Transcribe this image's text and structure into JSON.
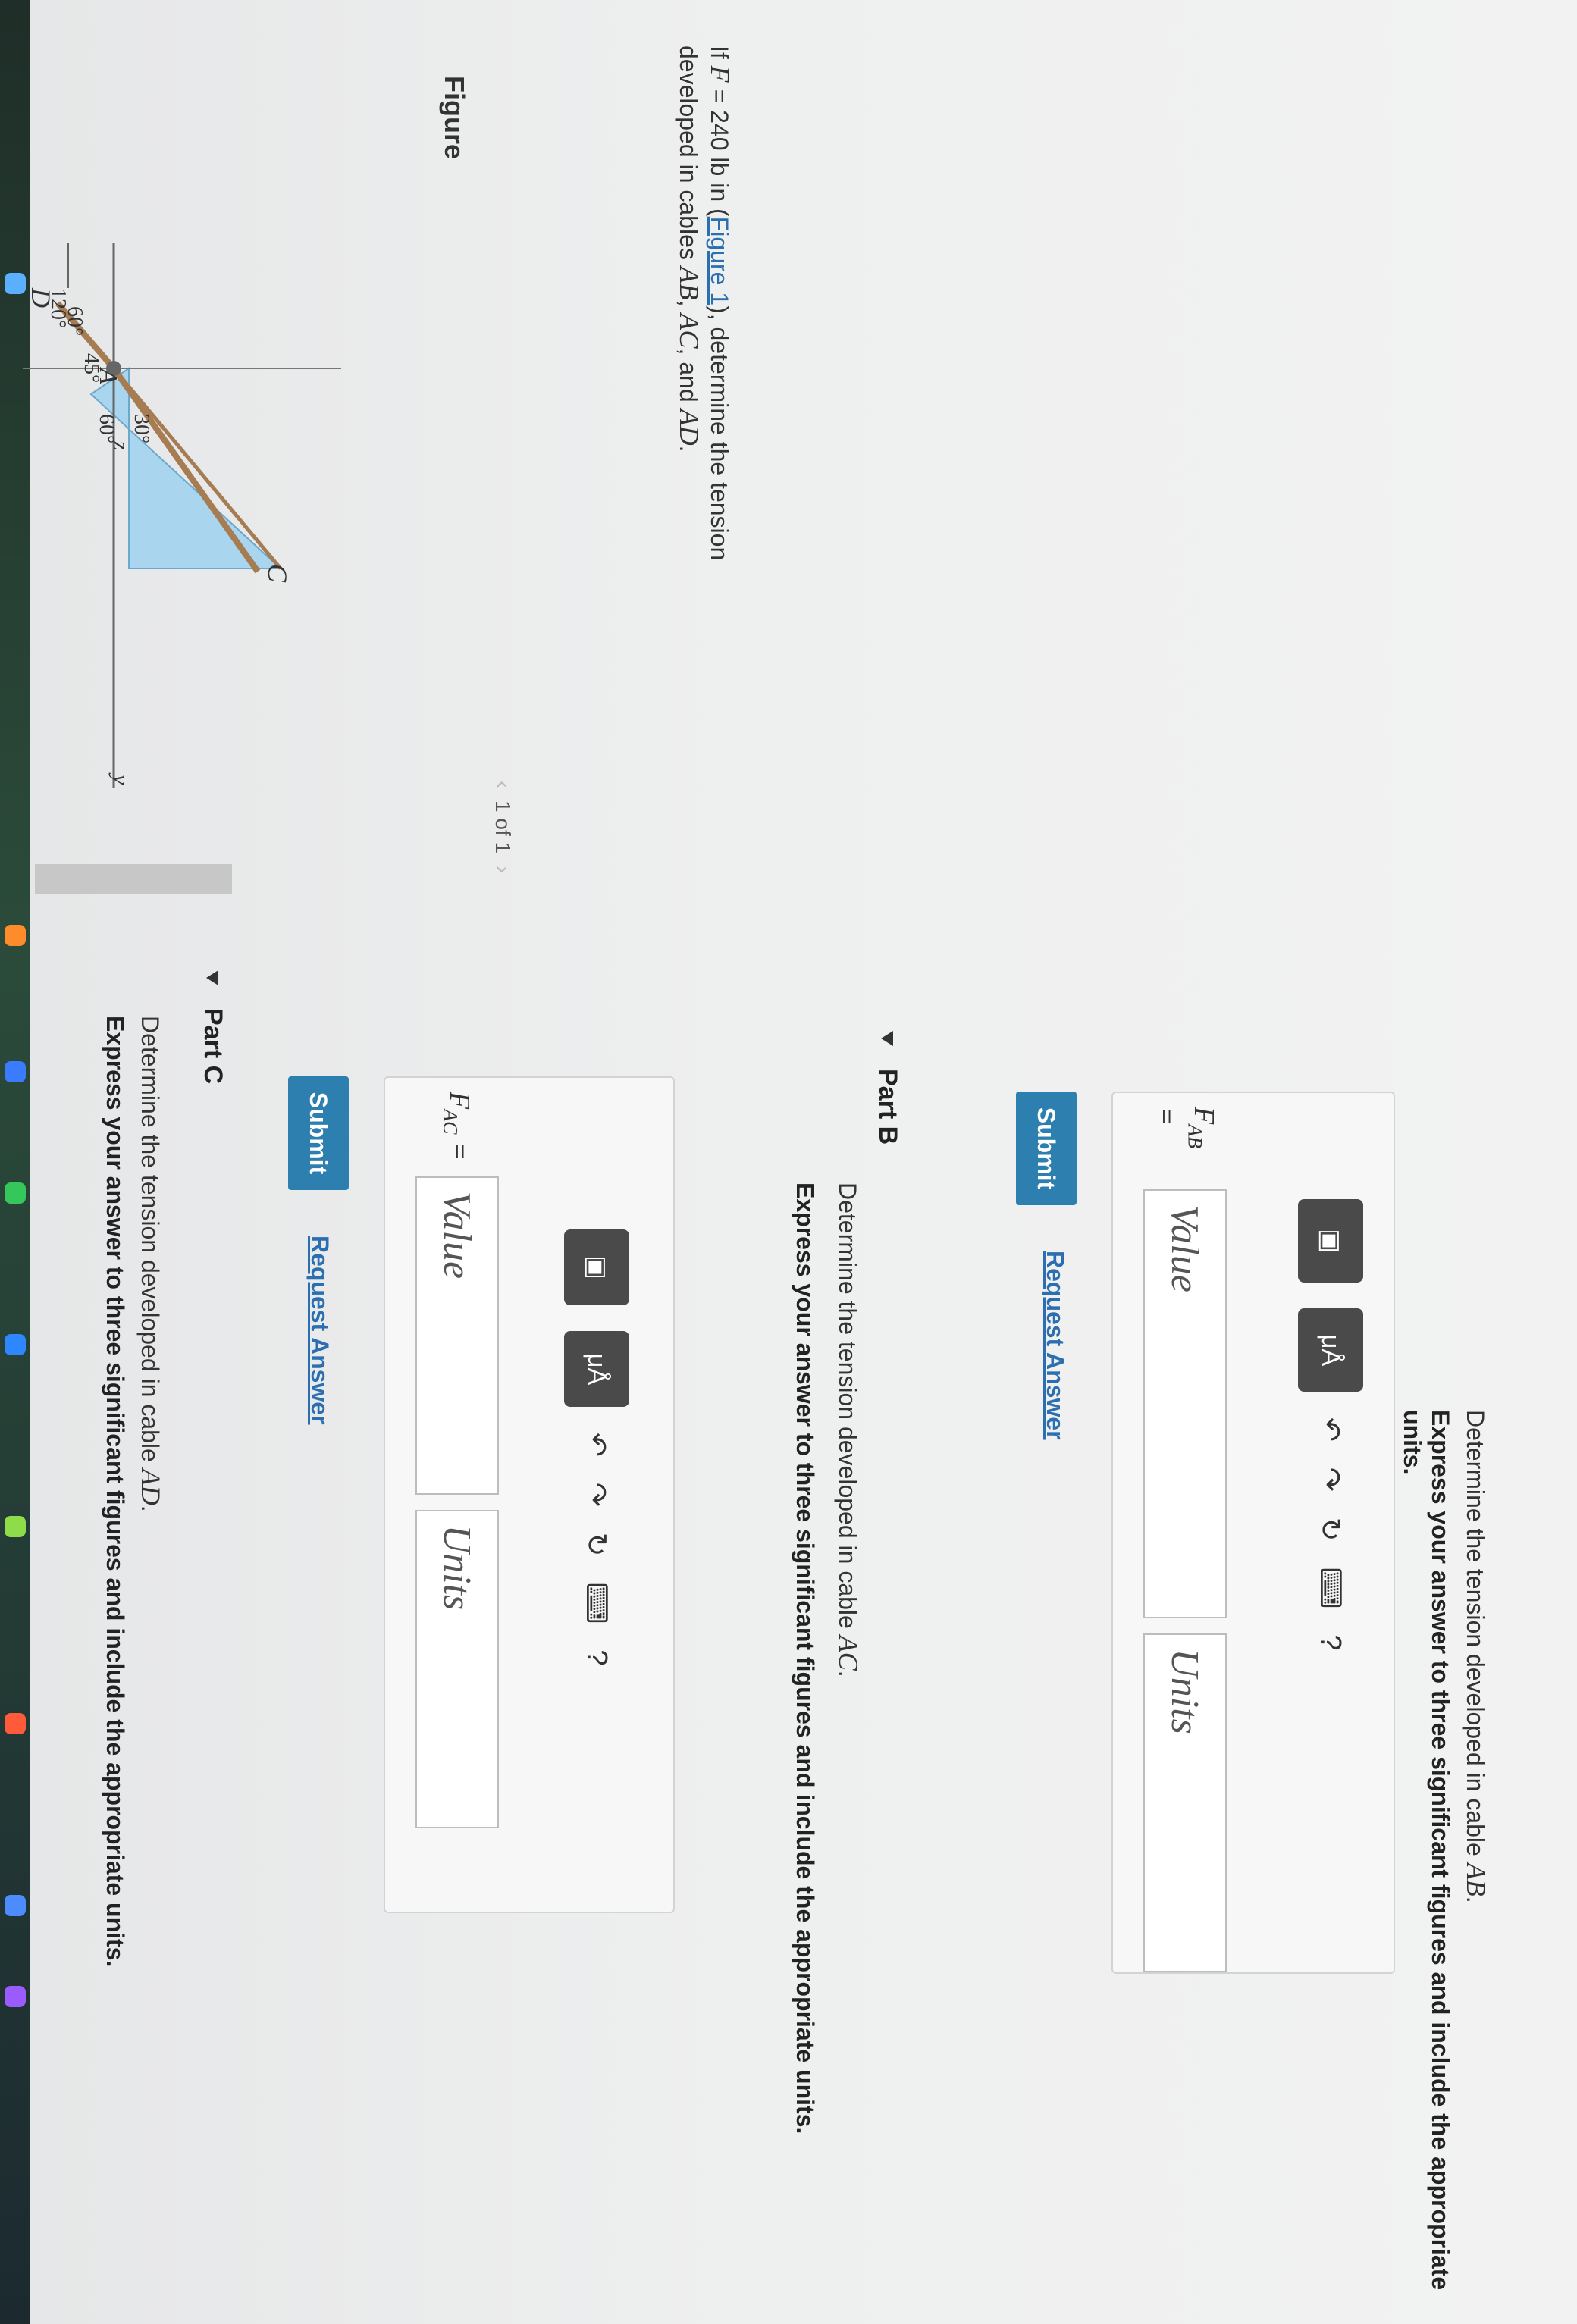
{
  "problem": {
    "intro_pre": "If ",
    "intro_f": "F",
    "intro_eq": " = 240 lb in (",
    "figure_link": "Figure 1",
    "intro_post": "), determine the tension",
    "intro_line2_pre": "developed in cables ",
    "cable_ab": "AB",
    "cable_ac": "AC",
    "cable_ad": "AD",
    "and": ", and ",
    "comma": ", ",
    "period": "."
  },
  "figure": {
    "title": "Figure",
    "pager": "1 of 1",
    "labels": {
      "d": "D",
      "a": "A",
      "c": "C",
      "z": "z",
      "y": "y",
      "ang_60_top": "60°",
      "ang_120": "120°",
      "ang_45": "45°",
      "ang_60_mid": "60°",
      "ang_30": "30°"
    }
  },
  "part_a": {
    "question_pre": "Determine the tension developed in cable ",
    "question_var": "AB",
    "question_post": ".",
    "instruction": "Express your answer to three significant figures and include the appropriate units.",
    "label_main": "F",
    "label_sub": "AB",
    "label_eq": " =",
    "value_placeholder": "Value",
    "units_placeholder": "Units",
    "submit": "Submit",
    "request": "Request Answer"
  },
  "part_b": {
    "title": "Part B",
    "question_pre": "Determine the tension developed in cable ",
    "question_var": "AC",
    "question_post": ".",
    "instruction": "Express your answer to three significant figures and include the appropriate units.",
    "label_main": "F",
    "label_sub": "AC",
    "label_eq": " =",
    "value_placeholder": "Value",
    "units_placeholder": "Units",
    "submit": "Submit",
    "request": "Request Answer"
  },
  "part_c": {
    "title": "Part C",
    "question_pre": "Determine the tension developed in cable ",
    "question_var": "AD",
    "question_post": ".",
    "instruction": "Express your answer to three significant figures and include the appropriate units."
  },
  "toolbar": {
    "template_icon": "fraction-template-icon",
    "units_icon": "mu-angstrom-icon",
    "units_label": "μÅ",
    "undo_icon": "undo-icon",
    "redo_icon": "redo-icon",
    "reset_icon": "reset-icon",
    "keyboard_icon": "keyboard-icon",
    "help_label": "?"
  }
}
